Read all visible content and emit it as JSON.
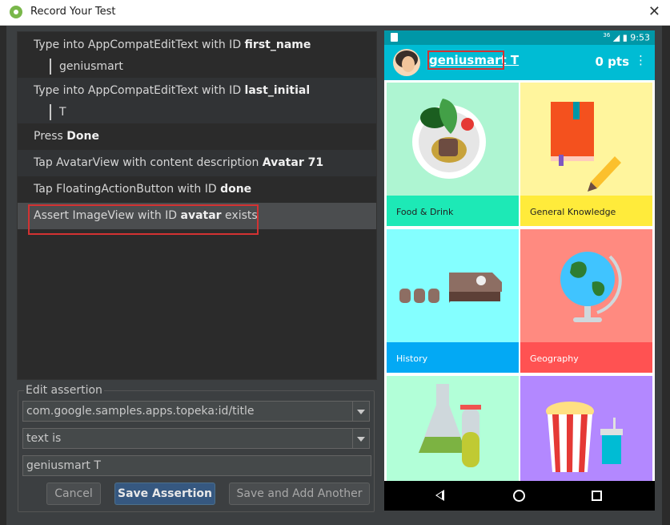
{
  "window": {
    "title": "Record Your Test"
  },
  "events": [
    {
      "prefix": "Type into AppCompatEditText with ID ",
      "bold": "first_name",
      "suffix": "",
      "sub": "geniusmart"
    },
    {
      "prefix": "Type into AppCompatEditText with ID ",
      "bold": "last_initial",
      "suffix": "",
      "sub": "T"
    },
    {
      "prefix": "Press ",
      "bold": "Done",
      "suffix": "",
      "sub": ""
    },
    {
      "prefix": "Tap AvatarView with content description ",
      "bold": "Avatar 71",
      "suffix": "",
      "sub": ""
    },
    {
      "prefix": "Tap FloatingActionButton with ID ",
      "bold": "done",
      "suffix": "",
      "sub": ""
    },
    {
      "prefix": "Assert ImageView with ID ",
      "bold": "avatar",
      "suffix": " exists",
      "sub": ""
    }
  ],
  "edit_assertion": {
    "label": "Edit assertion",
    "view_id": "com.google.samples.apps.topeka:id/title",
    "condition": "text is",
    "value": "geniusmart T",
    "cancel_label": "Cancel",
    "save_label": "Save Assertion",
    "save_add_label": "Save and Add Another"
  },
  "device": {
    "status_signal": "36",
    "status_time": "9:53",
    "app_title": "geniusmart T",
    "points": "0 pts",
    "more_icon": "⋮",
    "categories": [
      {
        "name": "Food & Drink",
        "bg": "#aef5d2",
        "band": "#1de9b6"
      },
      {
        "name": "General Knowledge",
        "bg": "#fff59d",
        "band": "#ffeb3b"
      },
      {
        "name": "History",
        "bg": "#84ffff",
        "band": "#03a9f4"
      },
      {
        "name": "Geography",
        "bg": "#ff8a80",
        "band": "#ff5252"
      },
      {
        "name": "",
        "bg": "#b2ffd8",
        "band": "#b2ffd8"
      },
      {
        "name": "",
        "bg": "#b388ff",
        "band": "#b388ff"
      }
    ]
  },
  "colors": {
    "highlight": "#d33232",
    "appbar": "#00bcd4",
    "statusbar": "#0097a7",
    "primary_button": "#365880"
  }
}
